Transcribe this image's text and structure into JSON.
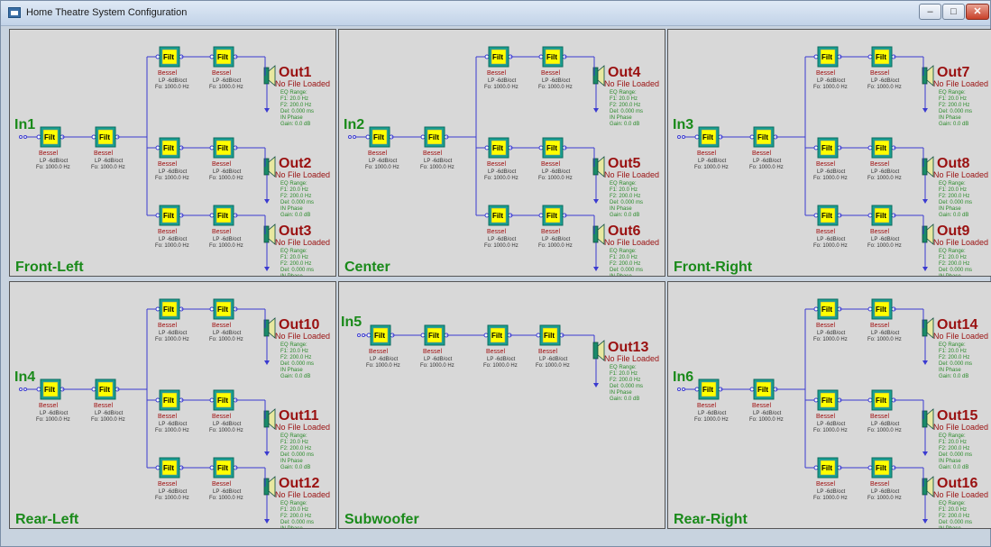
{
  "window": {
    "title": "Home Theatre System Configuration",
    "controls": {
      "minimize": "–",
      "maximize": "□",
      "close": "✕"
    }
  },
  "filter": {
    "box_label": "Filt",
    "type": "Bessel",
    "slope": "LP -6dB/oct",
    "freq": "Fo: 1000.0 Hz"
  },
  "output": {
    "status": "No File Loaded",
    "eq_range": "EQ Range:",
    "f1": "F1: 20.0 Hz",
    "f2": "F2: 200.0 Hz",
    "delay": "Del: 0.000 ms",
    "phase": "IN Phase",
    "gain": "Gain: 0.0 dB"
  },
  "panels": [
    {
      "name": "Front-Left",
      "input": "In1",
      "outputs": [
        "Out1",
        "Out2",
        "Out3"
      ]
    },
    {
      "name": "Center",
      "input": "In2",
      "outputs": [
        "Out4",
        "Out5",
        "Out6"
      ]
    },
    {
      "name": "Front-Right",
      "input": "In3",
      "outputs": [
        "Out7",
        "Out8",
        "Out9"
      ]
    },
    {
      "name": "Rear-Left",
      "input": "In4",
      "outputs": [
        "Out10",
        "Out11",
        "Out12"
      ]
    },
    {
      "name": "Subwoofer",
      "input": "In5",
      "outputs": [
        "Out13"
      ]
    },
    {
      "name": "Rear-Right",
      "input": "In6",
      "outputs": [
        "Out14",
        "Out15",
        "Out16"
      ]
    }
  ],
  "colors": {
    "channel_name": "#1a8a1a",
    "output_label": "#9a1111",
    "output_info": "#2a8a2a",
    "filter_label": "#a01010",
    "wire": "#3a3ad0",
    "filter_fill": "#ffff00",
    "filter_border": "#18a090"
  }
}
